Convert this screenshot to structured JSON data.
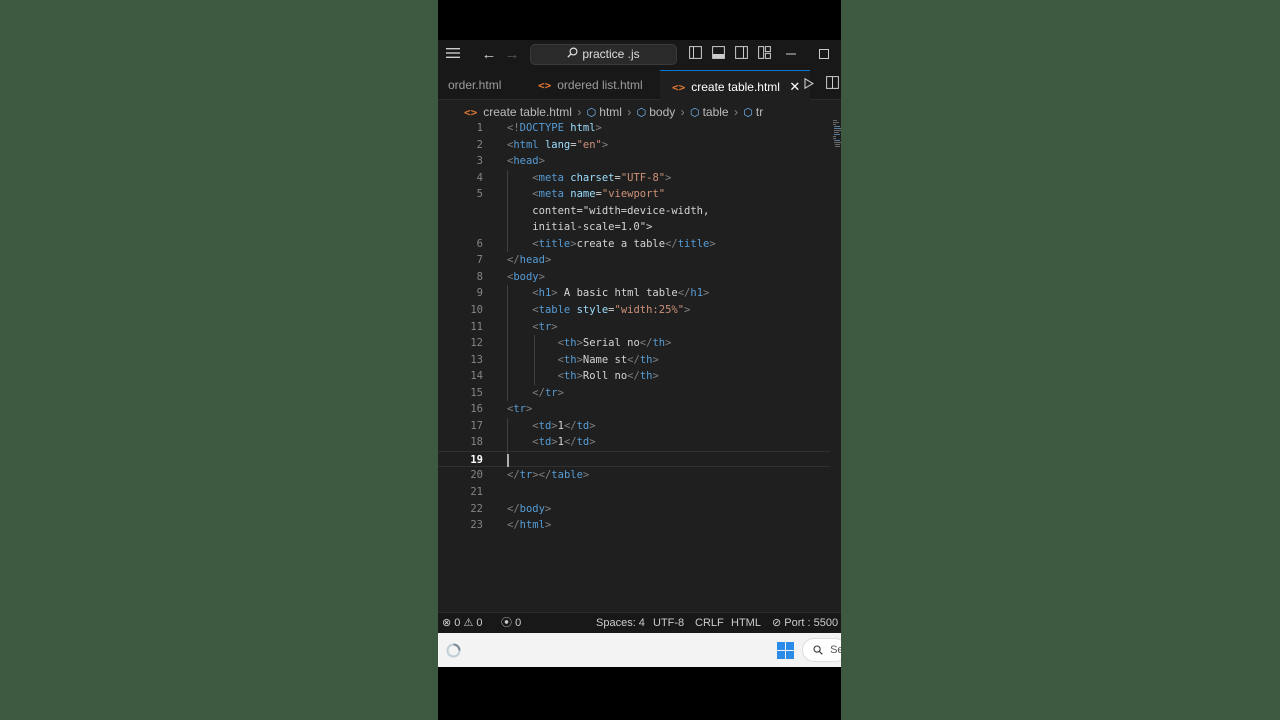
{
  "titlebar": {
    "search_text": "practice .js"
  },
  "tabs": [
    {
      "label": "order.html",
      "icon": "html-icon",
      "active": false
    },
    {
      "label": "ordered list.html",
      "icon": "html-icon",
      "active": false
    },
    {
      "label": "create table.html",
      "icon": "html-icon",
      "active": true
    }
  ],
  "breadcrumb": [
    "create table.html",
    "html",
    "body",
    "table",
    "tr"
  ],
  "editor": {
    "current_line": 19,
    "lines": [
      {
        "n": "1",
        "code": "<!DOCTYPE html>"
      },
      {
        "n": "2",
        "code": "<html lang=\"en\">"
      },
      {
        "n": "3",
        "code": "<head>"
      },
      {
        "n": "4",
        "code": "    <meta charset=\"UTF-8\">"
      },
      {
        "n": "5",
        "code": "    <meta name=\"viewport\""
      },
      {
        "n": "",
        "code": "    content=\"width=device-width,"
      },
      {
        "n": "",
        "code": "    initial-scale=1.0\">"
      },
      {
        "n": "6",
        "code": "    <title>create a table</title>"
      },
      {
        "n": "7",
        "code": "</head>"
      },
      {
        "n": "8",
        "code": "<body>"
      },
      {
        "n": "9",
        "code": "    <h1> A basic html table</h1>"
      },
      {
        "n": "10",
        "code": "    <table style=\"width:25%\">"
      },
      {
        "n": "11",
        "code": "    <tr>"
      },
      {
        "n": "12",
        "code": "        <th>Serial no</th>"
      },
      {
        "n": "13",
        "code": "        <th>Name st</th>"
      },
      {
        "n": "14",
        "code": "        <th>Roll no</th>"
      },
      {
        "n": "15",
        "code": "    </tr>"
      },
      {
        "n": "16",
        "code": "<tr>"
      },
      {
        "n": "17",
        "code": "    <td>1</td>"
      },
      {
        "n": "18",
        "code": "    <td>1</td>"
      },
      {
        "n": "19",
        "code": ""
      },
      {
        "n": "20",
        "code": "</tr></table>"
      },
      {
        "n": "21",
        "code": ""
      },
      {
        "n": "22",
        "code": "</body>"
      },
      {
        "n": "23",
        "code": "</html>"
      }
    ]
  },
  "statusbar": {
    "errors": "0",
    "warnings": "0",
    "ports": "0",
    "spaces": "Spaces: 4",
    "encoding": "UTF-8",
    "eol": "CRLF",
    "language": "HTML",
    "port": "Port : 5500"
  },
  "taskbar": {
    "search_text": "Se"
  },
  "colors": {
    "accent": "#0078d4",
    "html_icon": "#e37933",
    "background": "#1f1f1f"
  }
}
